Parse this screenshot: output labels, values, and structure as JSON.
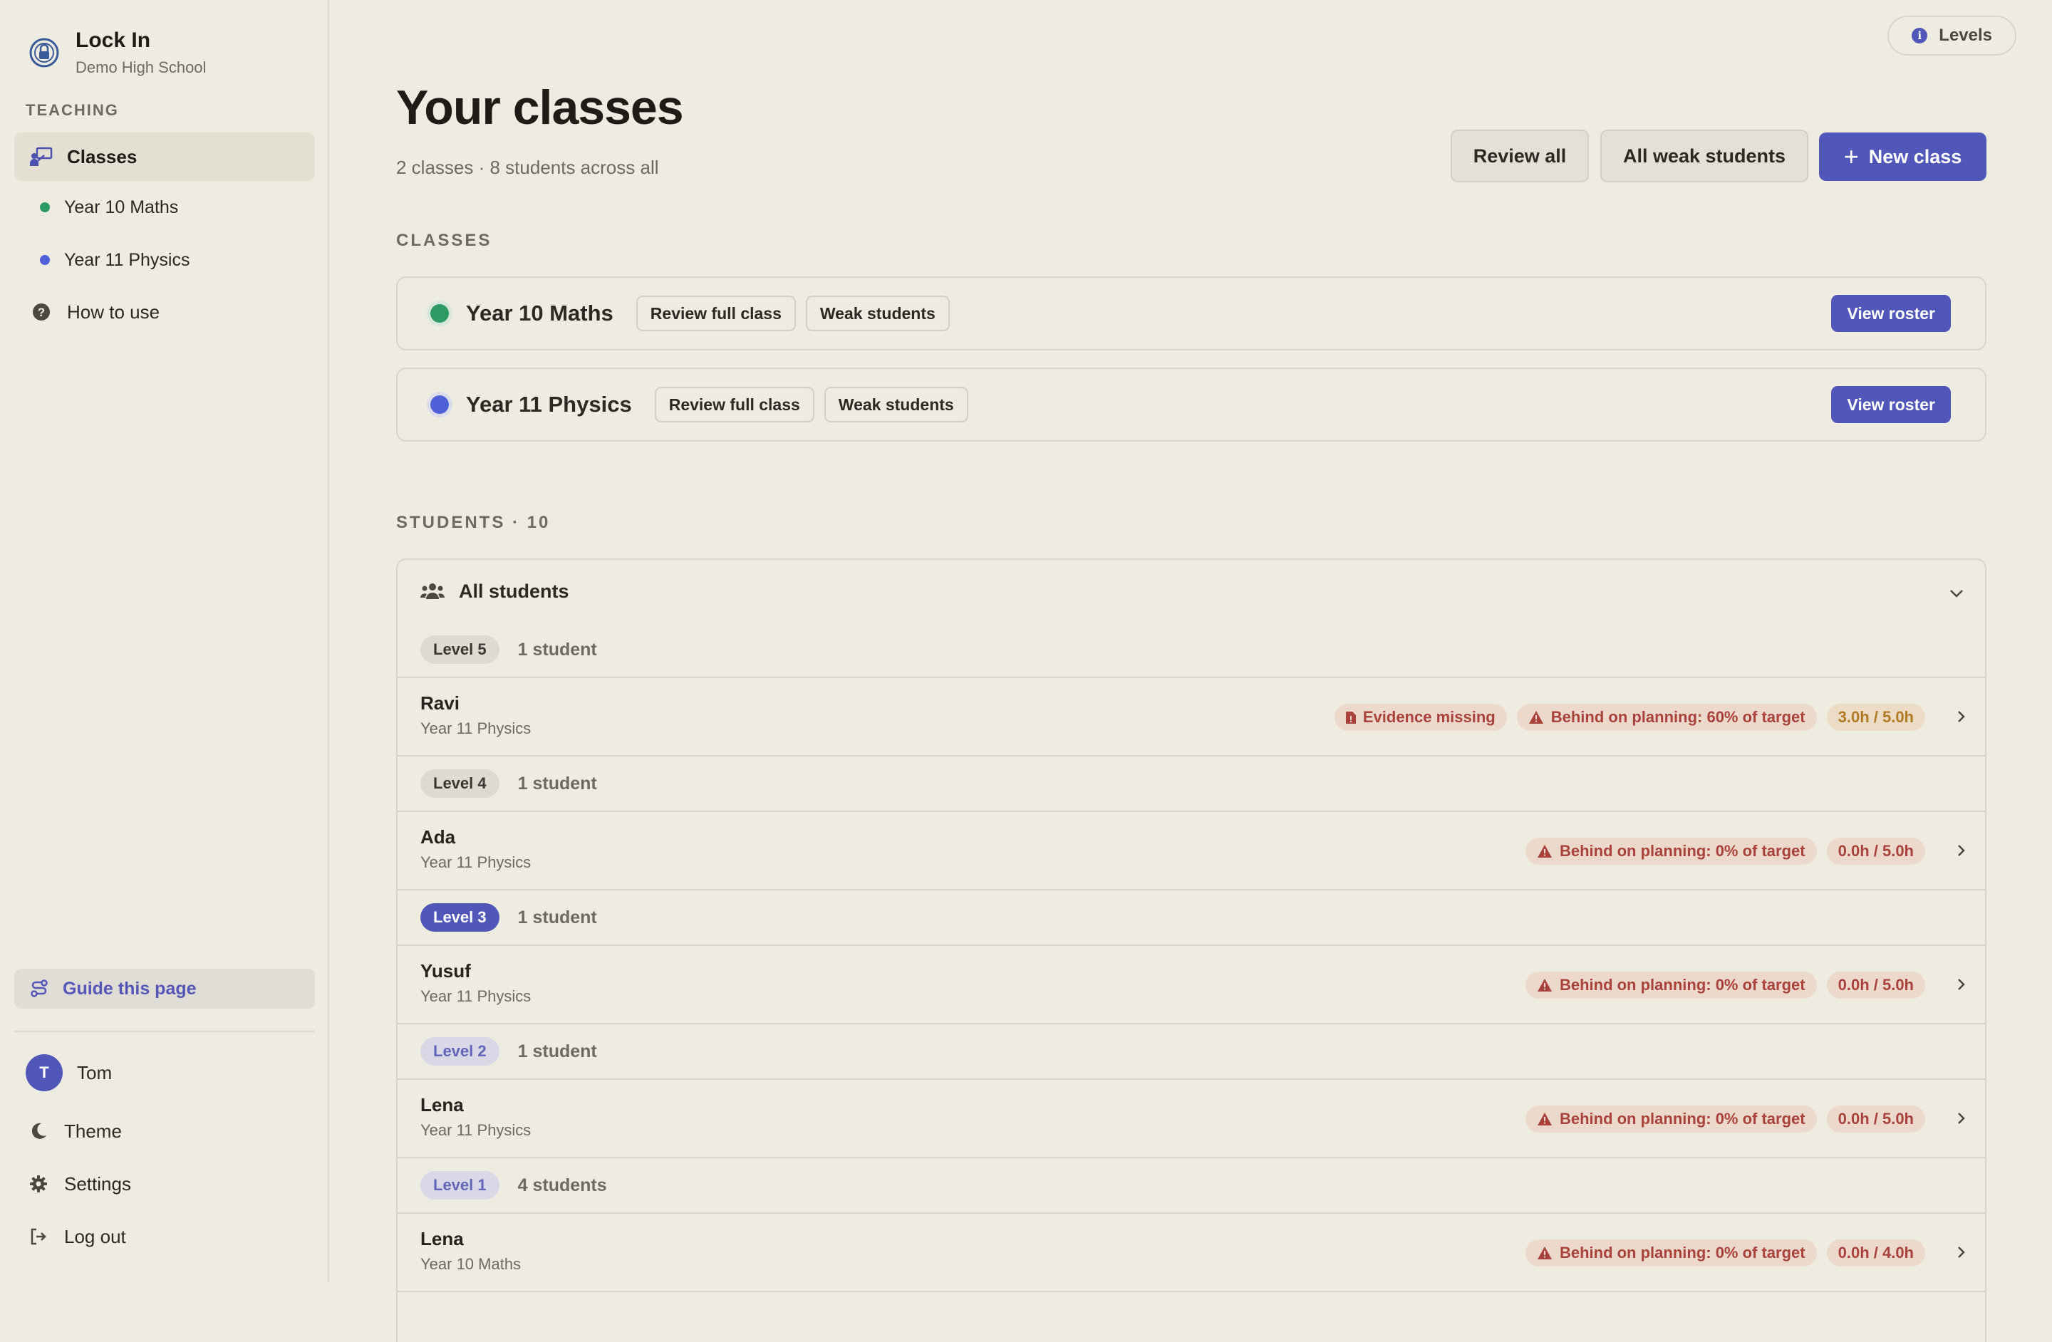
{
  "app": {
    "name": "Lock In",
    "school": "Demo High School"
  },
  "sidebar": {
    "section_label": "TEACHING",
    "classes_label": "Classes",
    "classes": [
      {
        "label": "Year 10 Maths",
        "color": "#2e9a63"
      },
      {
        "label": "Year 11 Physics",
        "color": "#5060d8"
      }
    ],
    "how_to_use": "How to use",
    "guide_label": "Guide this page",
    "user": {
      "initial": "T",
      "name": "Tom"
    },
    "theme_label": "Theme",
    "settings_label": "Settings",
    "logout_label": "Log out"
  },
  "header": {
    "levels_label": "Levels",
    "title": "Your classes",
    "subtitle": "2 classes · 8 students across all",
    "review_all": "Review all",
    "all_weak": "All weak students",
    "new_class": "New class"
  },
  "classes_section": {
    "label": "CLASSES",
    "items": [
      {
        "name": "Year 10 Maths",
        "color": "#2e9a63",
        "review": "Review full class",
        "weak": "Weak students",
        "roster": "View roster"
      },
      {
        "name": "Year 11 Physics",
        "color": "#5060d8",
        "review": "Review full class",
        "weak": "Weak students",
        "roster": "View roster"
      }
    ]
  },
  "students_section": {
    "label": "STUDENTS · 10",
    "panel_title": "All students",
    "groups": [
      {
        "level": "Level 5",
        "count": "1 student",
        "students": [
          {
            "name": "Ravi",
            "class": "Year 11 Physics",
            "evidence": "Evidence missing",
            "behind": "Behind on planning: 60% of target",
            "hours": "3.0h / 5.0h"
          }
        ]
      },
      {
        "level": "Level 4",
        "count": "1 student",
        "students": [
          {
            "name": "Ada",
            "class": "Year 11 Physics",
            "behind": "Behind on planning: 0% of target",
            "hours": "0.0h / 5.0h"
          }
        ]
      },
      {
        "level": "Level 3",
        "count": "1 student",
        "students": [
          {
            "name": "Yusuf",
            "class": "Year 11 Physics",
            "behind": "Behind on planning: 0% of target",
            "hours": "0.0h / 5.0h"
          }
        ]
      },
      {
        "level": "Level 2",
        "count": "1 student",
        "students": [
          {
            "name": "Lena",
            "class": "Year 11 Physics",
            "behind": "Behind on planning: 0% of target",
            "hours": "0.0h / 5.0h"
          }
        ]
      },
      {
        "level": "Level 1",
        "count": "4 students",
        "students": [
          {
            "name": "Lena",
            "class": "Year 10 Maths",
            "behind": "Behind on planning: 0% of target",
            "hours": "0.0h / 4.0h"
          }
        ]
      }
    ]
  }
}
